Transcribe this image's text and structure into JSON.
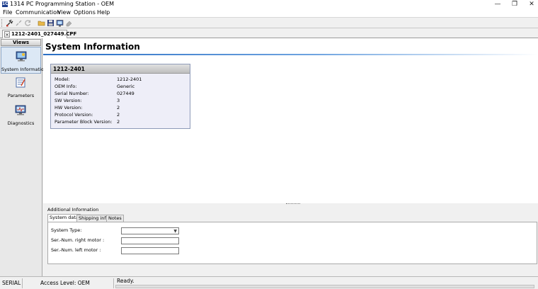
{
  "window": {
    "title": "1314 PC Programming Station - OEM",
    "app_icon_text": "1C",
    "min_glyph": "—",
    "max_glyph": "❐",
    "close_glyph": "✕"
  },
  "menu": [
    {
      "label": "File"
    },
    {
      "label": "Communication"
    },
    {
      "label": "View"
    },
    {
      "label": "Options"
    },
    {
      "label": "Help"
    }
  ],
  "toolbar": {
    "icons": [
      "connect-icon",
      "disconnect-icon",
      "refresh-icon",
      "open-folder-icon",
      "save-icon",
      "program-icon",
      "erase-icon"
    ]
  },
  "document_tab": {
    "label": "1212-2401_027449.CPF",
    "close_glyph": "×"
  },
  "views": {
    "header": "Views",
    "items": [
      {
        "label": "System Information",
        "icon": "system-information-icon",
        "selected": true
      },
      {
        "label": "Parameters",
        "icon": "parameters-icon",
        "selected": false
      },
      {
        "label": "Diagnostics",
        "icon": "diagnostics-icon",
        "selected": false
      }
    ]
  },
  "main": {
    "title": "System Information",
    "info_box": {
      "header": "1212-2401",
      "rows": [
        {
          "label": "Model:",
          "value": "1212-2401"
        },
        {
          "label": "OEM Info:",
          "value": "Generic"
        },
        {
          "label": "Serial Number:",
          "value": "027449"
        },
        {
          "label": "SW Version:",
          "value": "3"
        },
        {
          "label": "HW Version:",
          "value": "2"
        },
        {
          "label": "Protocol Version:",
          "value": "2"
        },
        {
          "label": "Parameter Block Version:",
          "value": "2"
        }
      ]
    }
  },
  "additional": {
    "title": "Additional Information",
    "tabs": [
      {
        "label": "System data",
        "active": true
      },
      {
        "label": "Shipping info",
        "active": false
      },
      {
        "label": "Notes",
        "active": false
      }
    ],
    "fields": [
      {
        "label": "System Type:",
        "value": ""
      },
      {
        "label": "Ser.-Num. right motor :",
        "value": ""
      },
      {
        "label": "Ser.-Num. left motor :",
        "value": ""
      }
    ]
  },
  "status": {
    "port": "SERIAL",
    "access_level": "Access Level: OEM",
    "state": "Ready."
  },
  "colors": {
    "accent": "#2b6fc4",
    "selected_view_bg": "#dce8f5"
  }
}
